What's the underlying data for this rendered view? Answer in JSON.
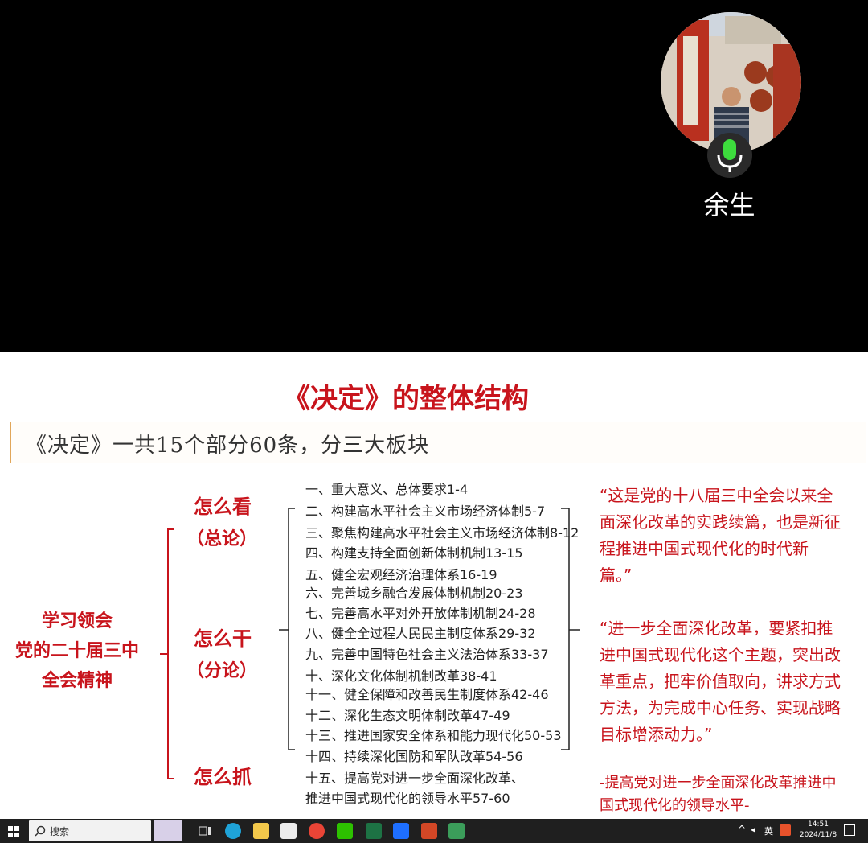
{
  "call": {
    "participant_name": "余生"
  },
  "slide": {
    "title": "《决定》的整体结构",
    "subtitle": "《决定》一共15个部分60条，分三大板块",
    "left_title_lines": [
      "学习领会",
      "党的二十届三中",
      "全会精神"
    ],
    "categories": [
      {
        "label": "怎么看",
        "sub": "（总论）"
      },
      {
        "label": "怎么干",
        "sub": "（分论）"
      },
      {
        "label": "怎么抓",
        "sub": ""
      }
    ],
    "sections": [
      "一、重大意义、总体要求1-4",
      "二、构建高水平社会主义市场经济体制5-7",
      "三、聚焦构建高水平社会主义市场经济体制8-12",
      "四、构建支持全面创新体制机制13-15",
      "五、健全宏观经济治理体系16-19",
      "六、完善城乡融合发展体制机制20-23",
      "七、完善高水平对外开放体制机制24-28",
      "八、健全全过程人民民主制度体系29-32",
      "九、完善中国特色社会主义法治体系33-37",
      "十、深化文化体制机制改革38-41",
      "十一、健全保障和改善民生制度体系42-46",
      "十二、深化生态文明体制改革47-49",
      "十三、推进国家安全体系和能力现代化50-53",
      "十四、持续深化国防和军队改革54-56",
      "十五、提高党对进一步全面深化改革、",
      "推进中国式现代化的领导水平57-60"
    ],
    "quotes": [
      "“这是党的十八届三中全会以来全面深化改革的实践续篇，也是新征程推进中国式现代化的时代新篇。”",
      "“进一步全面深化改革，要紧扣推进中国式现代化这个主题，突出改革重点，把牢价值取向，讲求方式方法，为完成中心任务、实现战略目标增添动力。”",
      "-提高党对进一步全面深化改革推进中国式现代化的领导水平-"
    ]
  },
  "taskbar": {
    "search_label": "搜索",
    "lang": "英",
    "time": "14:51",
    "date": "2024/11/8"
  },
  "colors": {
    "accent_red": "#c8141c",
    "mic_green": "#3ddc3d",
    "taskbar_bg": "#1f1f1f"
  }
}
